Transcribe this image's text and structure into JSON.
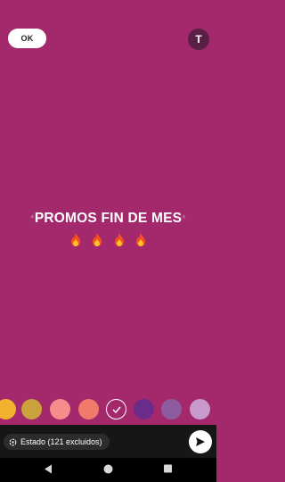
{
  "header": {
    "ok_label": "OK",
    "text_tool_label": "T"
  },
  "status": {
    "title": "PROMOS FIN DE MES",
    "decoration": "*",
    "emoji": [
      "fire",
      "fire",
      "fire",
      "fire"
    ]
  },
  "palette": {
    "swatches": [
      "#f2b12e",
      "#cba23b",
      "#f48d8c",
      "#f27a6b",
      "selected",
      "#6b2b8a",
      "#8c5c9e",
      "#c89acb"
    ]
  },
  "footer": {
    "audience_label": "Estado (121 excluidos)",
    "audience_icon": "status-icon",
    "send_icon": "send-icon"
  },
  "colors": {
    "background": "#a3296c",
    "footer": "#161616"
  }
}
